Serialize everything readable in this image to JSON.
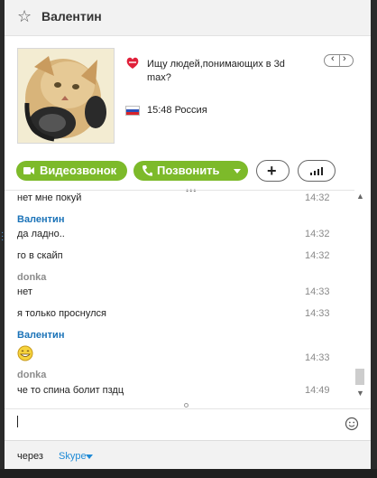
{
  "header": {
    "contact_name": "Валентин",
    "favorite_icon": "star-outline-icon"
  },
  "profile": {
    "mood": "Ищу людей,понимающих в 3d max?",
    "mood_icon": "skype-heart-icon",
    "local_time": "15:48 Россия",
    "flag_icon": "russia-flag-icon",
    "nav_prev": "‹",
    "nav_next": "›"
  },
  "actions": {
    "video_call_label": "Видеозвонок",
    "call_label": "Позвонить",
    "add_icon": "plus-icon",
    "quality_icon": "signal-bars-icon",
    "accent_color": "#7dba2a"
  },
  "messages": [
    {
      "sender": "",
      "text": "нет мне покуй",
      "time": "14:32"
    },
    {
      "sender": "Валентин",
      "text": "да ладно..",
      "time": "14:32"
    },
    {
      "sender": "",
      "text": "го в скайп",
      "time": "14:32"
    },
    {
      "sender": "donka",
      "text": "нет",
      "time": "14:33"
    },
    {
      "sender": "",
      "text": "я только проснулся",
      "time": "14:33"
    },
    {
      "sender": "Валентин",
      "text": "",
      "time": "14:33",
      "emoticon": "grin-icon"
    },
    {
      "sender": "donka",
      "text": "че то спина болит пздц",
      "time": "14:49"
    }
  ],
  "composer": {
    "value": "",
    "emoticon_icon": "smiley-icon"
  },
  "footer": {
    "via_label": "через",
    "via_link": "Skype"
  },
  "colors": {
    "sender_self": "#1b73b8",
    "sender_other": "#8c8c8c",
    "link": "#1e8ad6"
  }
}
